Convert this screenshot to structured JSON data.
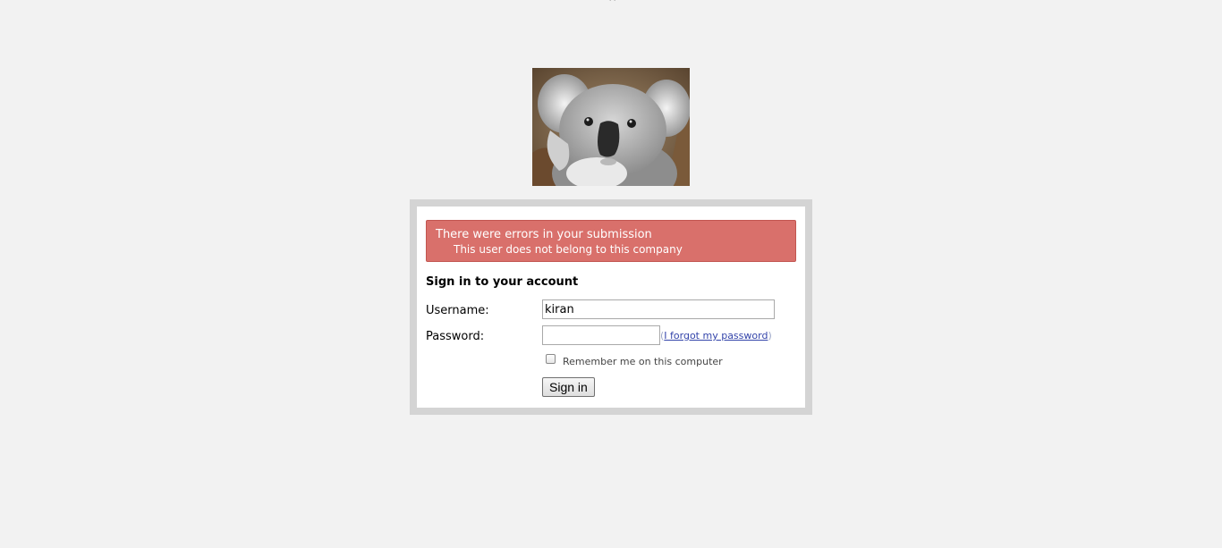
{
  "top_mark": "``",
  "logo": {
    "icon": "koala-image"
  },
  "error": {
    "title": "There were errors in your submission",
    "detail": "This user does not belong to this company",
    "color": "#d9706b"
  },
  "form": {
    "heading": "Sign in to your account",
    "username_label": "Username:",
    "username_value": "kiran",
    "password_label": "Password:",
    "password_value": "",
    "forgot_open": "(",
    "forgot_link": "I forgot my password",
    "forgot_close": ")",
    "remember_label": "Remember me on this computer",
    "remember_checked": false,
    "submit_label": "Sign in"
  }
}
